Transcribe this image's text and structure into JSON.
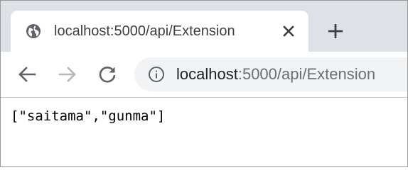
{
  "browser": {
    "tab": {
      "favicon": "globe-icon",
      "title": "localhost:5000/api/Extension",
      "close_icon": "close-icon"
    },
    "new_tab_icon": "plus-icon",
    "toolbar": {
      "back_icon": "arrow-left-icon",
      "forward_icon": "arrow-right-icon",
      "reload_icon": "reload-icon",
      "site_info_icon": "info-icon"
    },
    "address_bar": {
      "host": "localhost",
      "path": ":5000/api/Extension"
    }
  },
  "page": {
    "body_text": "[\"saitama\",\"gunma\"]"
  },
  "colors": {
    "tabstrip": "#dee1e6",
    "omnibox": "#f1f3f4",
    "icon": "#5f6368",
    "icon_disabled": "#b5b8bc"
  }
}
